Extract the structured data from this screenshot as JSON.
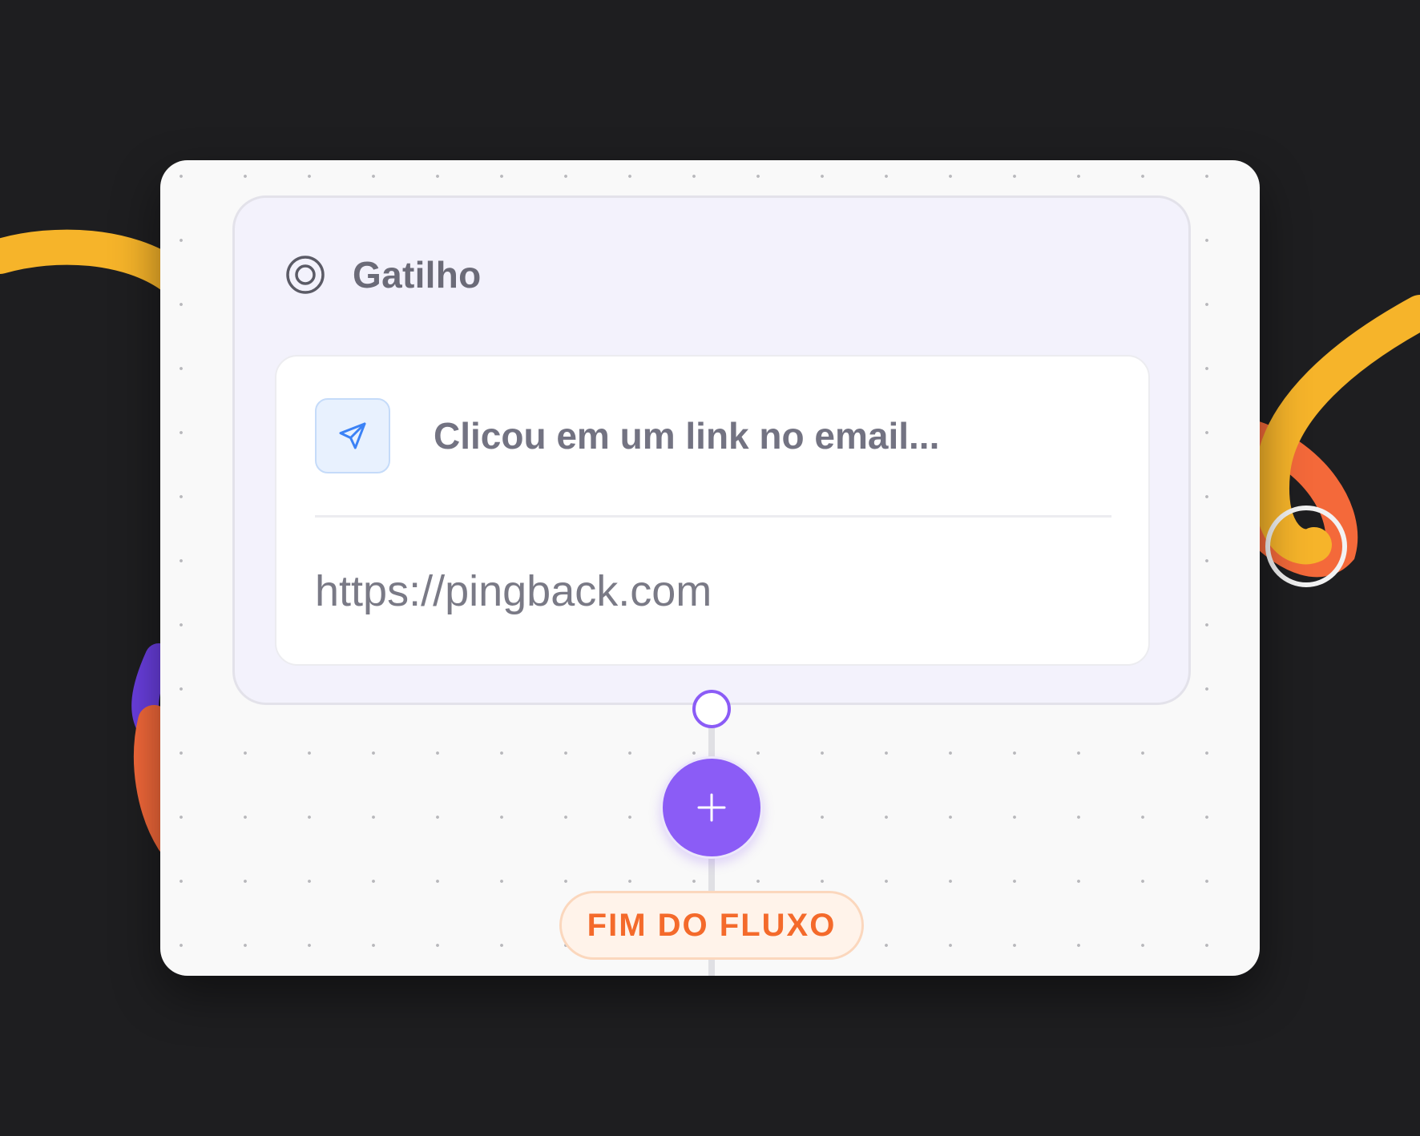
{
  "trigger": {
    "title": "Gatilho",
    "icon": "target-icon"
  },
  "event": {
    "icon": "send-icon",
    "title": "Clicou em um link no email...",
    "url": "https://pingback.com"
  },
  "add_button": {
    "icon": "plus-icon"
  },
  "end": {
    "label": "FIM DO FLUXO"
  },
  "colors": {
    "accent_purple": "#8b5cf6",
    "end_orange": "#f46a2b",
    "ribbon_yellow": "#f6b42a",
    "ribbon_orange": "#f4693a",
    "background": "#1e1e20"
  }
}
